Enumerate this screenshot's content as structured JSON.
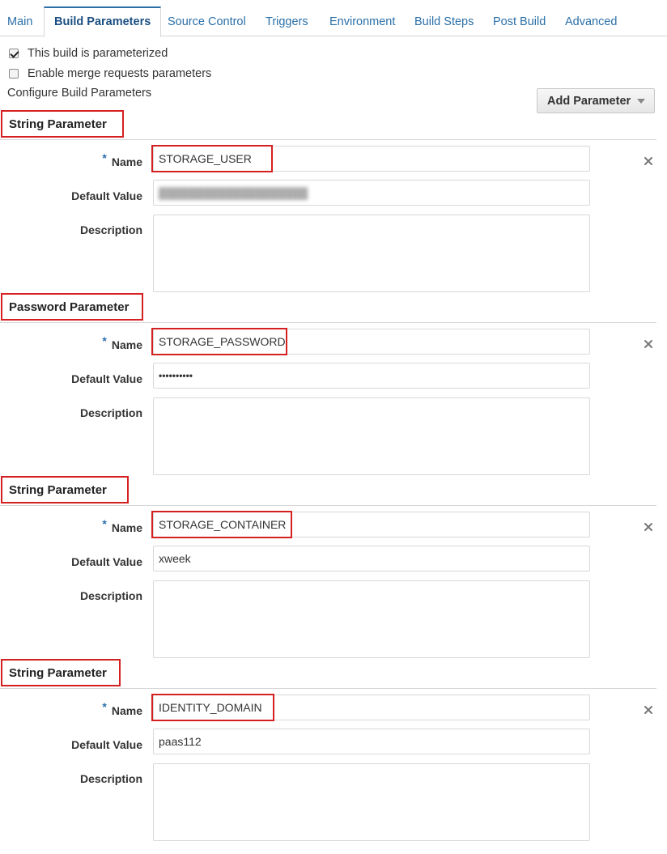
{
  "tabs": [
    "Main",
    "Build Parameters",
    "Source Control",
    "Triggers",
    "Environment",
    "Build Steps",
    "Post Build",
    "Advanced"
  ],
  "active_tab": "Build Parameters",
  "options": {
    "parameterized_label": "This build is parameterized",
    "parameterized_checked": true,
    "merge_label": "Enable merge requests parameters",
    "merge_checked": false
  },
  "configure_label": "Configure Build Parameters",
  "add_parameter_label": "Add Parameter",
  "field_labels": {
    "required_marker": "*",
    "name": "Name",
    "default_value": "Default Value",
    "description": "Description"
  },
  "parameters": [
    {
      "type": "String Parameter",
      "name": "STORAGE_USER",
      "default_value": "",
      "default_blurred": true,
      "description": ""
    },
    {
      "type": "Password Parameter",
      "name": "STORAGE_PASSWORD",
      "default_value": "••••••••••",
      "description": ""
    },
    {
      "type": "String Parameter",
      "name": "STORAGE_CONTAINER",
      "default_value": "xweek",
      "description": ""
    },
    {
      "type": "String Parameter",
      "name": "IDENTITY_DOMAIN",
      "default_value": "paas112",
      "description": ""
    }
  ],
  "icons": {
    "remove": "close-icon",
    "dropdown": "caret-down-icon",
    "checkbox": "checkbox-icon"
  },
  "colors": {
    "link": "#2a6fa8",
    "highlight": "#d42020",
    "required": "#2a6fa8"
  }
}
